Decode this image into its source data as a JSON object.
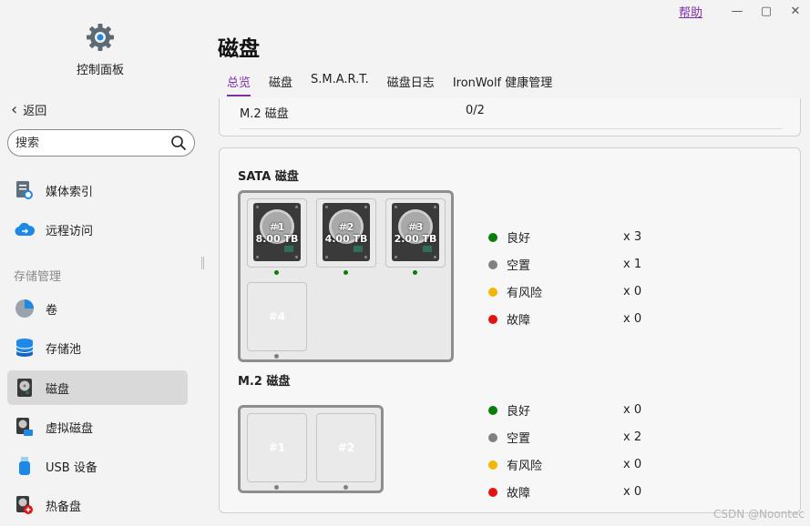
{
  "window": {
    "help": "帮助",
    "minimize": "—",
    "maximize": "▢",
    "close": "✕"
  },
  "sidebar": {
    "app_title": "控制面板",
    "back": "返回",
    "search_placeholder": "搜索",
    "items": [
      {
        "label": "媒体索引",
        "icon": "media-index-icon"
      },
      {
        "label": "远程访问",
        "icon": "cloud-remote-icon"
      }
    ],
    "section": "存储管理",
    "storage_items": [
      {
        "label": "卷",
        "icon": "volume-pie-icon"
      },
      {
        "label": "存储池",
        "icon": "storage-pool-icon"
      },
      {
        "label": "磁盘",
        "icon": "disk-icon",
        "active": true
      },
      {
        "label": "虚拟磁盘",
        "icon": "virtual-disk-icon"
      },
      {
        "label": "USB 设备",
        "icon": "usb-icon"
      },
      {
        "label": "热备盘",
        "icon": "hot-spare-icon"
      }
    ]
  },
  "main": {
    "title": "磁盘",
    "tabs": [
      "总览",
      "磁盘",
      "S.M.A.R.T.",
      "磁盘日志",
      "IronWolf 健康管理"
    ],
    "active_tab": 0,
    "summary_row": {
      "key": "M.2 磁盘",
      "value": "0/2"
    },
    "sata": {
      "title": "SATA 磁盘",
      "slots": [
        {
          "num": "#1",
          "size": "8.00 TB",
          "status": "good"
        },
        {
          "num": "#2",
          "size": "4.00 TB",
          "status": "good"
        },
        {
          "num": "#3",
          "size": "2.00 TB",
          "status": "good"
        },
        {
          "num": "#4",
          "size": "",
          "status": "empty"
        }
      ],
      "legend": [
        {
          "label": "良好",
          "count": "x 3",
          "color": "#0a7d0a"
        },
        {
          "label": "空置",
          "count": "x 1",
          "color": "#808080"
        },
        {
          "label": "有风险",
          "count": "x 0",
          "color": "#f2b705"
        },
        {
          "label": "故障",
          "count": "x 0",
          "color": "#e31212"
        }
      ]
    },
    "m2": {
      "title": "M.2 磁盘",
      "slots": [
        {
          "num": "#1",
          "status": "empty"
        },
        {
          "num": "#2",
          "status": "empty"
        }
      ],
      "legend": [
        {
          "label": "良好",
          "count": "x 0",
          "color": "#0a7d0a"
        },
        {
          "label": "空置",
          "count": "x 2",
          "color": "#808080"
        },
        {
          "label": "有风险",
          "count": "x 0",
          "color": "#f2b705"
        },
        {
          "label": "故障",
          "count": "x 0",
          "color": "#e31212"
        }
      ]
    }
  },
  "watermark": "CSDN @Noontec"
}
